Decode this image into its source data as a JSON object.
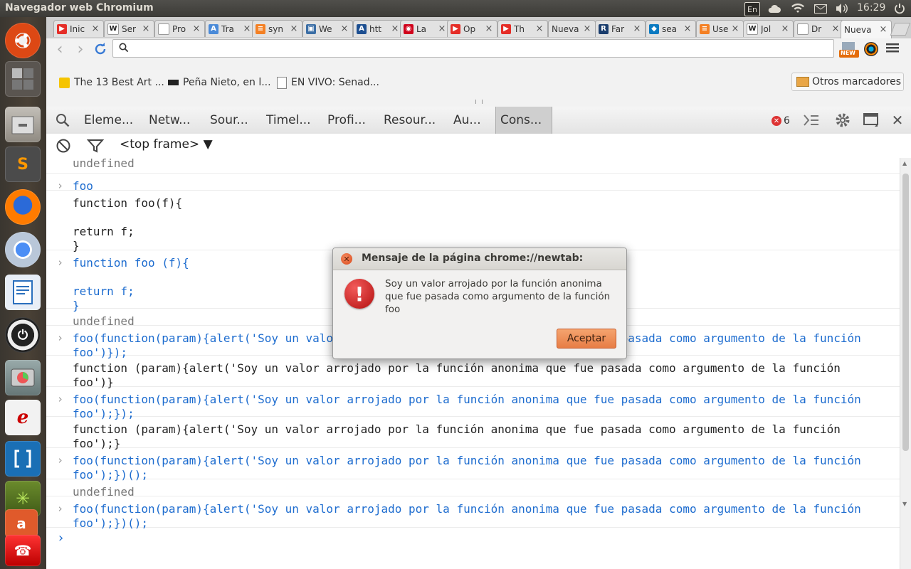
{
  "panel": {
    "window_title": "Navegador web Chromium",
    "keyboard": "En",
    "clock": "16:29"
  },
  "launcher": {
    "items": [
      "ubuntu-dash",
      "workspace-switcher",
      "file-manager",
      "sublime-text",
      "firefox",
      "chromium",
      "libreoffice-writer",
      "power-app",
      "disk-usage",
      "pdf-reader",
      "brackets",
      "cannabis-app",
      "ubuntu-software",
      "trash"
    ]
  },
  "tabs": [
    {
      "label": "Inic",
      "icon_color": "#e52d27",
      "icon_glyph": "▶"
    },
    {
      "label": "Ser",
      "icon_color": "#ffffff",
      "icon_glyph": "W"
    },
    {
      "label": "Pro",
      "icon_color": "#ffffff",
      "icon_glyph": ""
    },
    {
      "label": "Tra",
      "icon_color": "#4a8ad8",
      "icon_glyph": "A"
    },
    {
      "label": "syn",
      "icon_color": "#f48024",
      "icon_glyph": "≡"
    },
    {
      "label": "We",
      "icon_color": "#3b6ea5",
      "icon_glyph": "▣"
    },
    {
      "label": "htt",
      "icon_color": "#1d4f91",
      "icon_glyph": "A"
    },
    {
      "label": "La",
      "icon_color": "#d0021b",
      "icon_glyph": "◉"
    },
    {
      "label": "Op",
      "icon_color": "#e52d27",
      "icon_glyph": "▶"
    },
    {
      "label": "Th",
      "icon_color": "#e52d27",
      "icon_glyph": "▶"
    },
    {
      "label": "Nueva",
      "icon_color": "",
      "icon_glyph": ""
    },
    {
      "label": "Far",
      "icon_color": "#1a3d6d",
      "icon_glyph": "R"
    },
    {
      "label": "sea",
      "icon_color": "#0a7ac1",
      "icon_glyph": "◆"
    },
    {
      "label": "Use",
      "icon_color": "#f48024",
      "icon_glyph": "≡"
    },
    {
      "label": "Jol",
      "icon_color": "#ffffff",
      "icon_glyph": "W"
    },
    {
      "label": "Dr",
      "icon_color": "#ffffff",
      "icon_glyph": ""
    },
    {
      "label": "Nueva",
      "icon_color": "",
      "icon_glyph": ""
    }
  ],
  "toolbar": {
    "omnibox_value": "",
    "new_badge": "NEW"
  },
  "bookmarks": [
    {
      "label": "The 13 Best Art ..."
    },
    {
      "label": "Peña Nieto, en l..."
    },
    {
      "label": "EN VIVO: Senad..."
    }
  ],
  "other_bookmarks": "Otros marcadores",
  "devtools": {
    "tabs": [
      "Eleme...",
      "Netw...",
      "Sour...",
      "Timel...",
      "Profi...",
      "Resour...",
      "Au...",
      "Cons..."
    ],
    "error_count": "6",
    "frame_selector": "<top frame> ▼"
  },
  "console": {
    "lines": [
      {
        "kind": "out-undef",
        "text": "undefined"
      },
      {
        "kind": "in",
        "text": "foo"
      },
      {
        "kind": "out",
        "text": "function foo(f){\n\nreturn f;\n}"
      },
      {
        "kind": "in",
        "text": "function foo (f){\n\nreturn f;\n}"
      },
      {
        "kind": "out-undef",
        "text": "undefined"
      },
      {
        "kind": "in",
        "text": "foo(function(param){alert('Soy un valor arrojado por la función anonima que fue pasada como argumento de la función foo')});"
      },
      {
        "kind": "out",
        "text": "function (param){alert('Soy un valor arrojado por la función anonima que fue pasada como argumento de la función foo')}"
      },
      {
        "kind": "in",
        "text": "foo(function(param){alert('Soy un valor arrojado por la función anonima que fue pasada como argumento de la función foo');});"
      },
      {
        "kind": "out",
        "text": "function (param){alert('Soy un valor arrojado por la función anonima que fue pasada como argumento de la función foo');}"
      },
      {
        "kind": "in",
        "text": "foo(function(param){alert('Soy un valor arrojado por la función anonima que fue pasada como argumento de la función foo');})();"
      },
      {
        "kind": "out-undef",
        "text": "undefined"
      },
      {
        "kind": "in",
        "text": "foo(function(param){alert('Soy un valor arrojado por la función anonima que fue pasada como argumento de la función foo');})();"
      },
      {
        "kind": "prompt",
        "text": ""
      }
    ]
  },
  "dialog": {
    "title": "Mensaje de la página chrome://newtab:",
    "message": "Soy un valor arrojado por la función anonima que fue pasada como argumento de la función foo",
    "ok_label": "Aceptar"
  }
}
